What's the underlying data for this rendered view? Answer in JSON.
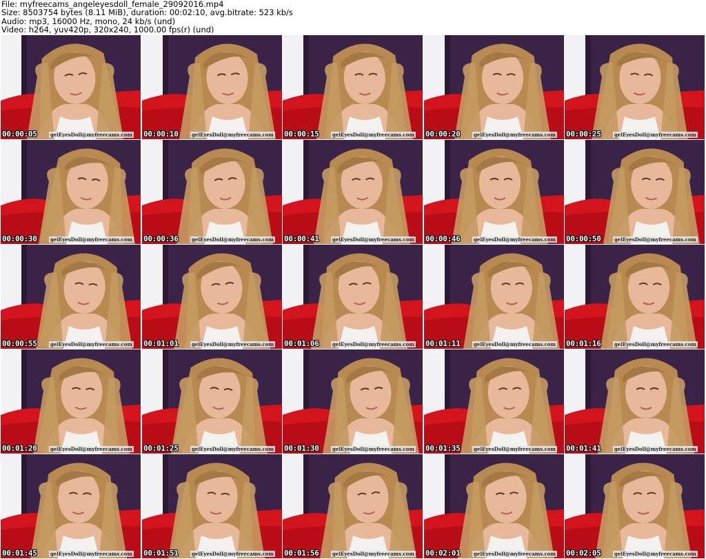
{
  "header": {
    "file_line": "File: myfreecams_angeleyesdoll_female_29092016.mp4",
    "size_line": "Size: 8503754 bytes (8.11 MiB), duration: 00:02:10, avg.bitrate: 523 kb/s",
    "audio_line": "Audio: mp3, 16000 Hz, mono, 24 kb/s (und)",
    "video_line": "Video: h264, yuv420p, 320x240, 1000.00 fps(r) (und)"
  },
  "watermark": "gelEyesDoll@myfreecams.com",
  "thumbnails": [
    {
      "timestamp": "00:00:05"
    },
    {
      "timestamp": "00:00:10"
    },
    {
      "timestamp": "00:00:15"
    },
    {
      "timestamp": "00:00:20"
    },
    {
      "timestamp": "00:00:25"
    },
    {
      "timestamp": "00:00:30"
    },
    {
      "timestamp": "00:00:36"
    },
    {
      "timestamp": "00:00:41"
    },
    {
      "timestamp": "00:00:46"
    },
    {
      "timestamp": "00:00:50"
    },
    {
      "timestamp": "00:00:55"
    },
    {
      "timestamp": "00:01:01"
    },
    {
      "timestamp": "00:01:06"
    },
    {
      "timestamp": "00:01:11"
    },
    {
      "timestamp": "00:01:16"
    },
    {
      "timestamp": "00:01:20"
    },
    {
      "timestamp": "00:01:25"
    },
    {
      "timestamp": "00:01:30"
    },
    {
      "timestamp": "00:01:35"
    },
    {
      "timestamp": "00:01:41"
    },
    {
      "timestamp": "00:01:45"
    },
    {
      "timestamp": "00:01:51"
    },
    {
      "timestamp": "00:01:56"
    },
    {
      "timestamp": "00:02:01"
    },
    {
      "timestamp": "00:02:05"
    }
  ],
  "colors": {
    "wall": "#3b2347",
    "wall_light": "#f2f2f4",
    "couch": "#d4141c",
    "hair": "#b88a52",
    "skin": "#e8b89a",
    "top": "#f4f2ee"
  }
}
